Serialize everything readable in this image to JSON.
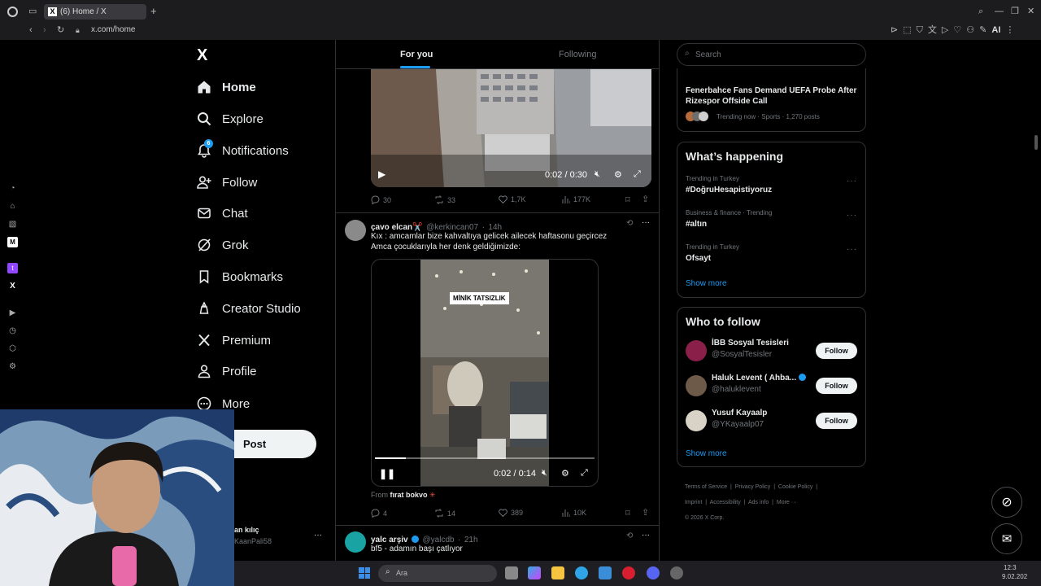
{
  "browser": {
    "tab_title": "(6) Home / X",
    "url": "x.com/home",
    "ai_label": "AI"
  },
  "nav": {
    "logo": "X",
    "items": [
      {
        "label": "Home",
        "icon": "home-icon",
        "active": true
      },
      {
        "label": "Explore",
        "icon": "search-icon"
      },
      {
        "label": "Notifications",
        "icon": "bell-icon",
        "badge": "6"
      },
      {
        "label": "Follow",
        "icon": "person-add-icon"
      },
      {
        "label": "Chat",
        "icon": "mail-icon"
      },
      {
        "label": "Grok",
        "icon": "grok-icon"
      },
      {
        "label": "Bookmarks",
        "icon": "bookmark-icon"
      },
      {
        "label": "Creator Studio",
        "icon": "creator-studio-icon"
      },
      {
        "label": "Premium",
        "icon": "x-premium-icon"
      },
      {
        "label": "Profile",
        "icon": "person-icon"
      },
      {
        "label": "More",
        "icon": "more-circle-icon"
      }
    ],
    "post_label": "Post",
    "account_name": "an kılıç",
    "account_handle": "KaanPali58",
    "account_more": "···"
  },
  "timeline": {
    "tabs": [
      {
        "label": "For you",
        "active": true
      },
      {
        "label": "Following"
      }
    ],
    "tweet1": {
      "video_time": "0:02 / 0:30",
      "progress": 0.05,
      "replies": "30",
      "reposts": "33",
      "likes": "1,7K",
      "views": "177K"
    },
    "tweet2": {
      "name": "çavo elcan",
      "name_emoji": "✂️",
      "handle": "@kerkincan07",
      "time": "14h",
      "text_line1": "Kıx : amcamlar bize kahvaltıya gelicek ailecek haftasonu geçircez",
      "text_line2": "Amca çocuklarıyla her denk geldiğimizde:",
      "video_caption": "MİNİK TATSIZLIK",
      "video_time": "0:02 / 0:14",
      "progress": 0.14,
      "from_label": "From",
      "from_name": "fırat bokvo",
      "replies": "4",
      "reposts": "14",
      "likes": "389",
      "views": "10K"
    },
    "tweet3": {
      "name": "yalc arşiv",
      "handle": "@yalcdb",
      "time": "21h",
      "text": "bf5 - adamın başı çatlıyor"
    }
  },
  "right": {
    "search_placeholder": "Search",
    "trend_top": {
      "title": "Fenerbahce Fans Demand UEFA Probe After Rizespor Offside Call",
      "meta": "Trending now · Sports · 1,270 posts"
    },
    "whats_happening": {
      "title": "What’s happening",
      "items": [
        {
          "context": "Trending in Turkey",
          "topic": "#DoğruHesapistiyoruz"
        },
        {
          "context": "Business & finance · Trending",
          "topic": "#altın"
        },
        {
          "context": "Trending in Turkey",
          "topic": "Ofsayt"
        }
      ],
      "show_more": "Show more"
    },
    "who_to_follow": {
      "title": "Who to follow",
      "accounts": [
        {
          "name": "İBB Sosyal Tesisleri",
          "handle": "@SosyalTesisler",
          "verified": false,
          "color": "#8a1f4a"
        },
        {
          "name": "Haluk Levent ( Ahba...",
          "handle": "@haluklevent",
          "verified": true,
          "color": "#6d5a48"
        },
        {
          "name": "Yusuf Kayaalp",
          "handle": "@YKayaalp07",
          "verified": false,
          "color": "#d9d2c6"
        }
      ],
      "follow_label": "Follow",
      "show_more": "Show more"
    },
    "footer": {
      "links": [
        "Terms of Service",
        "Privacy Policy",
        "Cookie Policy",
        "Imprint",
        "Accessibility",
        "Ads info",
        "More ···"
      ],
      "copyright": "© 2026 X Corp."
    }
  },
  "taskbar": {
    "search_placeholder": "Ara",
    "time": "12:3",
    "date": "9.02.202"
  },
  "colors": {
    "accent": "#1d9bf0",
    "background": "#000000",
    "border": "#2f3336"
  }
}
